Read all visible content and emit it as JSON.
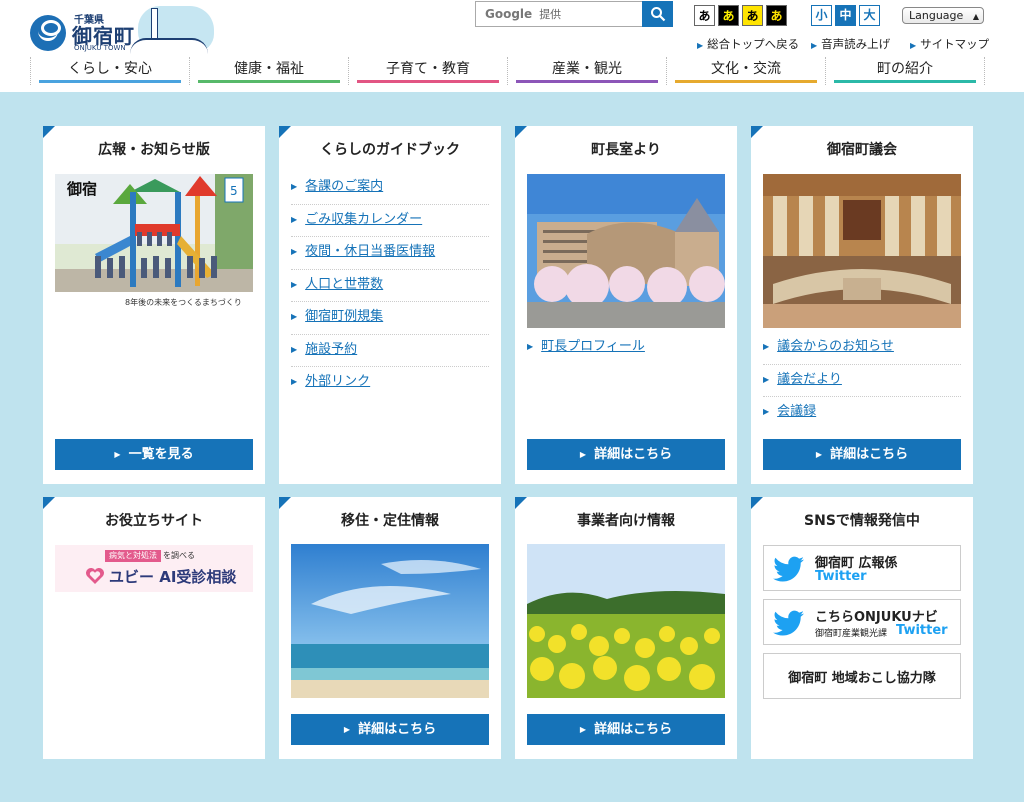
{
  "header": {
    "logo": {
      "prefecture": "千葉県",
      "town": "御宿町",
      "roman": "ONJUKU TOWN"
    },
    "search": {
      "brand": "Google",
      "placeholder": "提供"
    },
    "color_buttons": [
      "あ",
      "あ",
      "あ",
      "あ"
    ],
    "size_buttons": [
      "小",
      "中",
      "大"
    ],
    "language": "Language",
    "util_links": [
      "総合トップへ戻る",
      "音声読み上げ",
      "サイトマップ"
    ]
  },
  "nav": [
    {
      "label": "くらし・安心",
      "color": "#4aa3df"
    },
    {
      "label": "健康・福祉",
      "color": "#57b96a"
    },
    {
      "label": "子育て・教育",
      "color": "#e25583"
    },
    {
      "label": "産業・観光",
      "color": "#8c56b8"
    },
    {
      "label": "文化・交流",
      "color": "#e6aa2e"
    },
    {
      "label": "町の紹介",
      "color": "#2bb9a8"
    }
  ],
  "cards": [
    {
      "title": "広報・お知らせ版",
      "button": "一覧を見る",
      "photo": "広報おんじゅく表紙",
      "caption": "8年後の未来をつくるまちづくり"
    },
    {
      "title": "くらしのガイドブック",
      "links": [
        "各課のご案内",
        "ごみ収集カレンダー",
        "夜間・休日当番医情報",
        "人口と世帯数",
        "御宿町例規集",
        "施設予約",
        "外部リンク"
      ]
    },
    {
      "title": "町長室より",
      "links": [
        "町長プロフィール"
      ],
      "button": "詳細はこちら"
    },
    {
      "title": "御宿町議会",
      "links": [
        "議会からのお知らせ",
        "議会だより",
        "会議録"
      ],
      "button": "詳細はこちら"
    },
    {
      "title": "お役立ちサイト",
      "ubie": {
        "tag": "病気と対処法",
        "tag2": "を調べる",
        "name": "ユビー AI受診相談"
      }
    },
    {
      "title": "移住・定住情報",
      "button": "詳細はこちら"
    },
    {
      "title": "事業者向け情報",
      "button": "詳細はこちら"
    },
    {
      "title": "SNSで情報発信中",
      "sns": [
        {
          "line1": "御宿町 広報係",
          "line2": "Twitter"
        },
        {
          "line1": "こちらONJUKUナビ",
          "sub": "御宿町産業観光課",
          "line2": "Twitter"
        },
        {
          "label": "御宿町 地域おこし協力隊"
        }
      ]
    }
  ]
}
